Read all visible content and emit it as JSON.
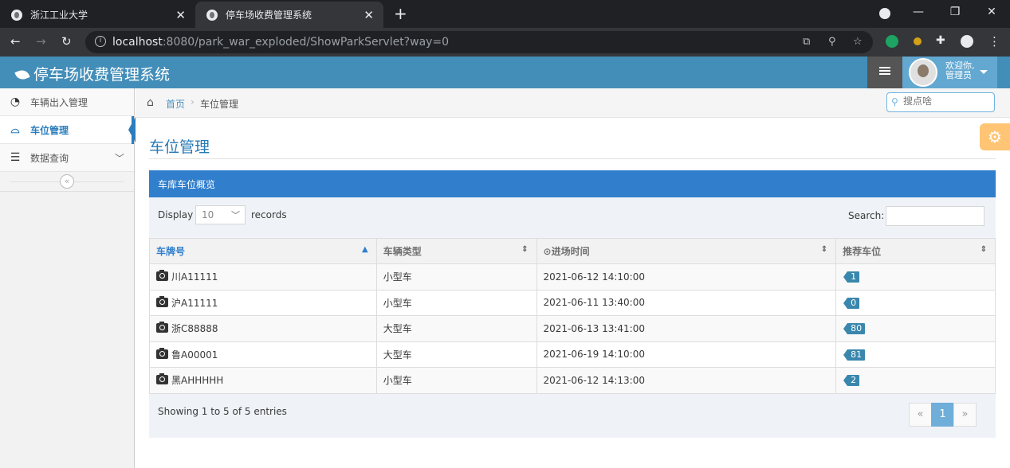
{
  "browser": {
    "tabs": [
      {
        "title": "浙江工业大学"
      },
      {
        "title": "停车场收费管理系统"
      }
    ],
    "url_host": "localhost",
    "url_rest": ":8080/park_war_exploded/ShowParkServlet?way=0"
  },
  "header": {
    "brand": "停车场收费管理系统",
    "welcome": "欢迎你,",
    "user": "管理员"
  },
  "sidebar": {
    "items": [
      {
        "label": "车辆出入管理",
        "icon": "tachometer-icon"
      },
      {
        "label": "车位管理",
        "icon": "inbox-icon"
      },
      {
        "label": "数据查询",
        "icon": "list-icon"
      }
    ],
    "collapse": "«"
  },
  "breadcrumb": {
    "home": "首页",
    "current": "车位管理",
    "search_placeholder": "搜点啥"
  },
  "page": {
    "title": "车位管理",
    "widget_title": "车库车位概览"
  },
  "table_controls": {
    "display": "Display",
    "page_size": "10",
    "records": "records",
    "search": "Search:",
    "info": "Showing 1 to 5 of 5 entries",
    "prev": "«",
    "current_page": "1",
    "next": "»"
  },
  "table": {
    "headers": [
      "车牌号",
      "车辆类型",
      "进场时间",
      "推荐车位"
    ],
    "rows": [
      {
        "plate": "川A11111",
        "type": "小型车",
        "time": "2021-06-12 14:10:00",
        "slot": "1"
      },
      {
        "plate": "沪A11111",
        "type": "小型车",
        "time": "2021-06-11 13:40:00",
        "slot": "0"
      },
      {
        "plate": "浙C88888",
        "type": "大型车",
        "time": "2021-06-13 13:41:00",
        "slot": "80"
      },
      {
        "plate": "鲁A00001",
        "type": "大型车",
        "time": "2021-06-19 14:10:00",
        "slot": "81"
      },
      {
        "plate": "黑AHHHHH",
        "type": "小型车",
        "time": "2021-06-12 14:13:00",
        "slot": "2"
      }
    ]
  }
}
